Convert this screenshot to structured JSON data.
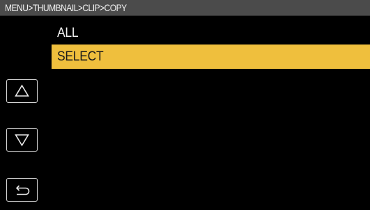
{
  "header": {
    "breadcrumb": "MENU>THUMBNAIL>CLIP>COPY"
  },
  "menu": {
    "items": [
      {
        "label": "ALL",
        "selected": false
      },
      {
        "label": "SELECT",
        "selected": true
      }
    ],
    "highlight_color": "#efbf3d"
  },
  "controls": {
    "up_icon": "triangle-up-icon",
    "down_icon": "triangle-down-icon",
    "back_icon": "return-arrow-icon"
  }
}
